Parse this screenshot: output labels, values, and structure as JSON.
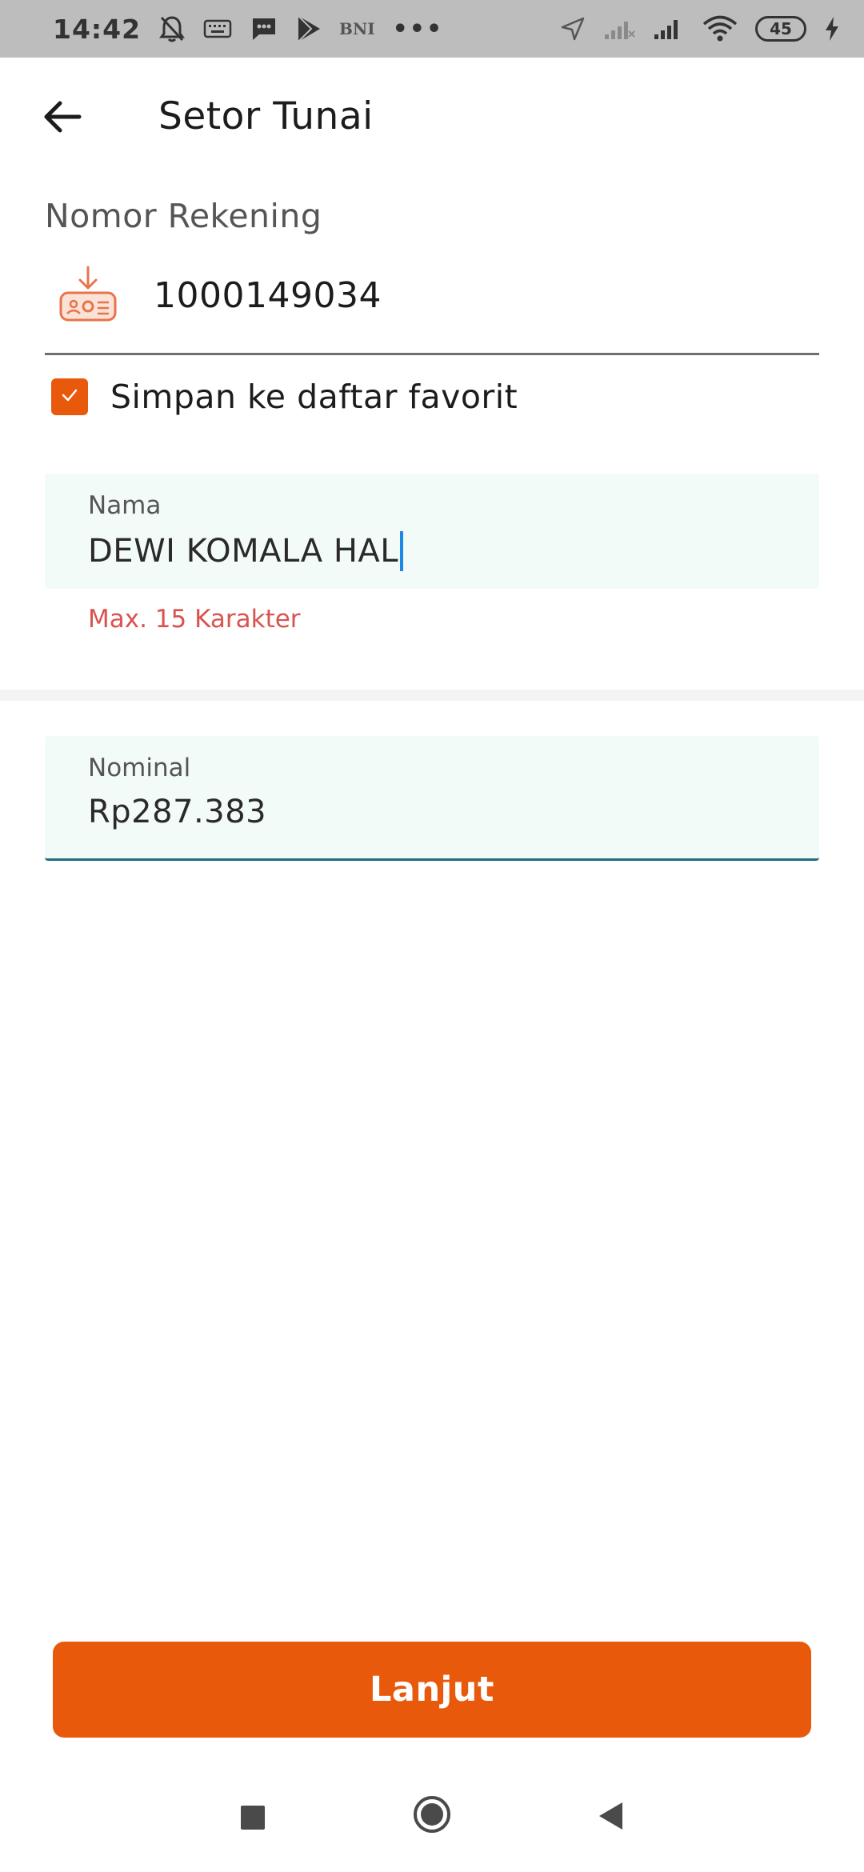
{
  "status_bar": {
    "time": "14:42",
    "carrier_label": "BNI",
    "more_dots": "•••",
    "battery_level": "45",
    "icons": [
      "bell-off-icon",
      "keyboard-icon",
      "message-icon",
      "play-store-icon",
      "location-icon",
      "signal-icon",
      "signal-icon",
      "wifi-icon",
      "battery-icon",
      "charging-icon"
    ]
  },
  "app_bar": {
    "title": "Setor Tunai",
    "back_icon": "arrow-left-icon"
  },
  "account": {
    "label": "Nomor Rekening",
    "number": "1000149034",
    "icon": "cash-deposit-icon"
  },
  "favorite": {
    "label": "Simpan ke daftar favorit",
    "checked": true
  },
  "name_field": {
    "label": "Nama",
    "value": "DEWI KOMALA HAL",
    "helper": "Max. 15 Karakter"
  },
  "nominal_field": {
    "label": "Nominal",
    "value": "Rp287.383"
  },
  "continue_button": {
    "label": "Lanjut"
  },
  "colors": {
    "primary": "#e8590c",
    "field_bg": "#f3fbf9",
    "error": "#d9534f",
    "focus_underline": "#1f6e7e",
    "caret": "#1e88e5"
  }
}
